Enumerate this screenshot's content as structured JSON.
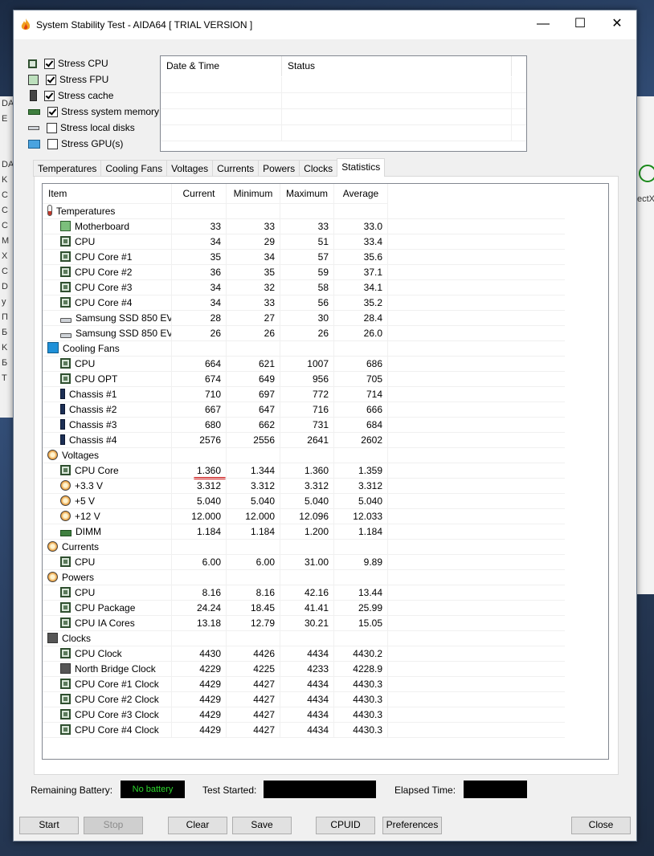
{
  "window": {
    "title": "System Stability Test - AIDA64  [ TRIAL VERSION ]"
  },
  "stress": [
    {
      "label": "Stress CPU",
      "checked": true,
      "icon": "cpu-chip-icon"
    },
    {
      "label": "Stress FPU",
      "checked": true,
      "icon": "fpu-icon"
    },
    {
      "label": "Stress cache",
      "checked": true,
      "icon": "cache-icon"
    },
    {
      "label": "Stress system memory",
      "checked": true,
      "icon": "memory-icon"
    },
    {
      "label": "Stress local disks",
      "checked": false,
      "icon": "disk-icon"
    },
    {
      "label": "Stress GPU(s)",
      "checked": false,
      "icon": "gpu-icon"
    }
  ],
  "log": {
    "col_datetime": "Date & Time",
    "col_status": "Status"
  },
  "tabs": [
    "Temperatures",
    "Cooling Fans",
    "Voltages",
    "Currents",
    "Powers",
    "Clocks",
    "Statistics"
  ],
  "active_tab": "Statistics",
  "grid": {
    "headers": [
      "Item",
      "Current",
      "Minimum",
      "Maximum",
      "Average"
    ],
    "rows": [
      {
        "type": "group",
        "icon": "thermo",
        "label": "Temperatures"
      },
      {
        "type": "item",
        "icon": "board",
        "label": "Motherboard",
        "v": [
          "33",
          "33",
          "33",
          "33.0"
        ]
      },
      {
        "type": "item",
        "icon": "chip",
        "label": "CPU",
        "v": [
          "34",
          "29",
          "51",
          "33.4"
        ]
      },
      {
        "type": "item",
        "icon": "chip",
        "label": "CPU Core #1",
        "v": [
          "35",
          "34",
          "57",
          "35.6"
        ]
      },
      {
        "type": "item",
        "icon": "chip",
        "label": "CPU Core #2",
        "v": [
          "36",
          "35",
          "59",
          "37.1"
        ]
      },
      {
        "type": "item",
        "icon": "chip",
        "label": "CPU Core #3",
        "v": [
          "34",
          "32",
          "58",
          "34.1"
        ]
      },
      {
        "type": "item",
        "icon": "chip",
        "label": "CPU Core #4",
        "v": [
          "34",
          "33",
          "56",
          "35.2"
        ]
      },
      {
        "type": "item",
        "icon": "disk",
        "label": "Samsung SSD 850 EV...",
        "v": [
          "28",
          "27",
          "30",
          "28.4"
        ]
      },
      {
        "type": "item",
        "icon": "disk",
        "label": "Samsung SSD 850 EV...",
        "v": [
          "26",
          "26",
          "26",
          "26.0"
        ]
      },
      {
        "type": "group",
        "icon": "fanblue",
        "label": "Cooling Fans"
      },
      {
        "type": "item",
        "icon": "chip",
        "label": "CPU",
        "v": [
          "664",
          "621",
          "1007",
          "686"
        ]
      },
      {
        "type": "item",
        "icon": "chip",
        "label": "CPU OPT",
        "v": [
          "674",
          "649",
          "956",
          "705"
        ]
      },
      {
        "type": "item",
        "icon": "fan",
        "label": "Chassis #1",
        "v": [
          "710",
          "697",
          "772",
          "714"
        ]
      },
      {
        "type": "item",
        "icon": "fan",
        "label": "Chassis #2",
        "v": [
          "667",
          "647",
          "716",
          "666"
        ]
      },
      {
        "type": "item",
        "icon": "fan",
        "label": "Chassis #3",
        "v": [
          "680",
          "662",
          "731",
          "684"
        ]
      },
      {
        "type": "item",
        "icon": "fan",
        "label": "Chassis #4",
        "v": [
          "2576",
          "2556",
          "2641",
          "2602"
        ]
      },
      {
        "type": "group",
        "icon": "volt",
        "label": "Voltages"
      },
      {
        "type": "item",
        "icon": "chip",
        "label": "CPU Core",
        "v": [
          "1.360",
          "1.344",
          "1.360",
          "1.359"
        ]
      },
      {
        "type": "item",
        "icon": "volt",
        "label": "+3.3 V",
        "v": [
          "3.312",
          "3.312",
          "3.312",
          "3.312"
        ]
      },
      {
        "type": "item",
        "icon": "volt",
        "label": "+5 V",
        "v": [
          "5.040",
          "5.040",
          "5.040",
          "5.040"
        ]
      },
      {
        "type": "item",
        "icon": "volt",
        "label": "+12 V",
        "v": [
          "12.000",
          "12.000",
          "12.096",
          "12.033"
        ]
      },
      {
        "type": "item",
        "icon": "dimm",
        "label": "DIMM",
        "v": [
          "1.184",
          "1.184",
          "1.200",
          "1.184"
        ]
      },
      {
        "type": "group",
        "icon": "volt",
        "label": "Currents"
      },
      {
        "type": "item",
        "icon": "chip",
        "label": "CPU",
        "v": [
          "6.00",
          "6.00",
          "31.00",
          "9.89"
        ]
      },
      {
        "type": "group",
        "icon": "volt",
        "label": "Powers"
      },
      {
        "type": "item",
        "icon": "chip",
        "label": "CPU",
        "v": [
          "8.16",
          "8.16",
          "42.16",
          "13.44"
        ]
      },
      {
        "type": "item",
        "icon": "chip",
        "label": "CPU Package",
        "v": [
          "24.24",
          "18.45",
          "41.41",
          "25.99"
        ]
      },
      {
        "type": "item",
        "icon": "chip",
        "label": "CPU IA Cores",
        "v": [
          "13.18",
          "12.79",
          "30.21",
          "15.05"
        ]
      },
      {
        "type": "group",
        "icon": "clock",
        "label": "Clocks"
      },
      {
        "type": "item",
        "icon": "chip",
        "label": "CPU Clock",
        "v": [
          "4430",
          "4426",
          "4434",
          "4430.2"
        ]
      },
      {
        "type": "item",
        "icon": "clock",
        "label": "North Bridge Clock",
        "v": [
          "4229",
          "4225",
          "4233",
          "4228.9"
        ]
      },
      {
        "type": "item",
        "icon": "chip",
        "label": "CPU Core #1 Clock",
        "v": [
          "4429",
          "4427",
          "4434",
          "4430.3"
        ]
      },
      {
        "type": "item",
        "icon": "chip",
        "label": "CPU Core #2 Clock",
        "v": [
          "4429",
          "4427",
          "4434",
          "4430.3"
        ]
      },
      {
        "type": "item",
        "icon": "chip",
        "label": "CPU Core #3 Clock",
        "v": [
          "4429",
          "4427",
          "4434",
          "4430.3"
        ]
      },
      {
        "type": "item",
        "icon": "chip",
        "label": "CPU Core #4 Clock",
        "v": [
          "4429",
          "4427",
          "4434",
          "4430.3"
        ]
      }
    ]
  },
  "status": {
    "battery_label": "Remaining Battery:",
    "battery_value": "No battery",
    "started_label": "Test Started:",
    "elapsed_label": "Elapsed Time:"
  },
  "buttons": {
    "start": "Start",
    "stop": "Stop",
    "clear": "Clear",
    "save": "Save",
    "cpuid": "CPUID",
    "preferences": "Preferences",
    "close": "Close"
  },
  "background": {
    "left_strip": [
      "DA",
      "E",
      "",
      "",
      "DA",
      "K",
      "C",
      "C",
      "C",
      "M",
      "X",
      "C",
      "D",
      "y",
      "Π",
      "Б",
      "K",
      "Б",
      "T"
    ],
    "right_label": "ectX"
  }
}
